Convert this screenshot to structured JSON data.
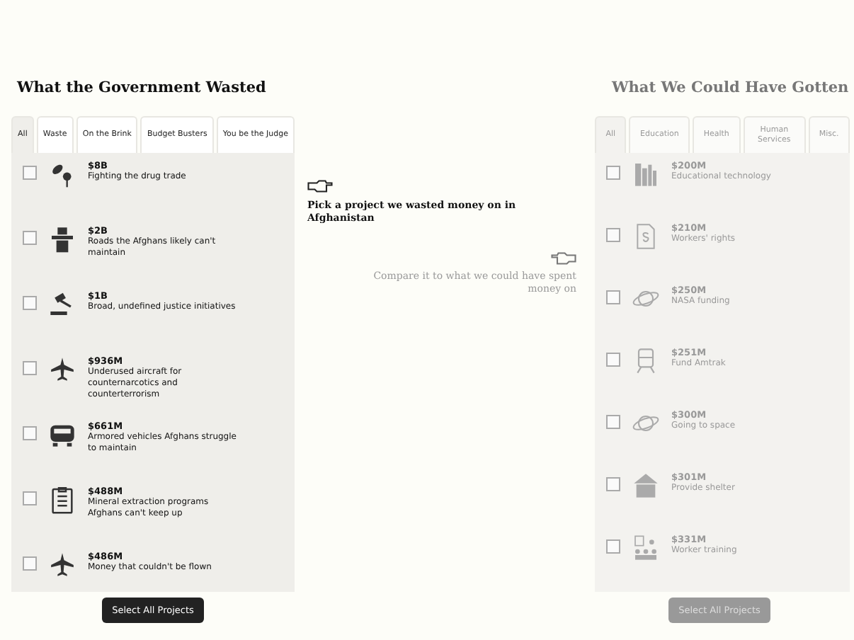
{
  "wasted": {
    "title": "What the Government Wasted",
    "disabled": false,
    "tabs": [
      {
        "label": "All",
        "selected": true
      },
      {
        "label": "Waste",
        "selected": false
      },
      {
        "label": "On the Brink",
        "selected": false
      },
      {
        "label": "Budget Busters",
        "selected": false
      },
      {
        "label": "You be the Judge",
        "selected": false
      }
    ],
    "items": [
      {
        "amount": "$8B",
        "text": "Fighting the drug trade",
        "kind": "plant",
        "checked": false
      },
      {
        "amount": "$2B",
        "text": "Roads the Afghans likely can't maintain",
        "kind": "road",
        "checked": false
      },
      {
        "amount": "$1B",
        "text": "Broad, undefined justice initiatives",
        "kind": "gavel",
        "checked": false
      },
      {
        "amount": "$936M",
        "text": "Underused aircraft for counternarcotics and counterterrorism",
        "kind": "plane",
        "checked": false
      },
      {
        "amount": "$661M",
        "text": "Armored vehicles Afghans struggle to maintain",
        "kind": "vehicle",
        "checked": false
      },
      {
        "amount": "$488M",
        "text": "Mineral extraction programs Afghans can't keep up",
        "kind": "clipboard",
        "checked": false
      },
      {
        "amount": "$486M",
        "text": "Money that couldn't be flown",
        "kind": "plane",
        "checked": false
      }
    ],
    "button": "Select All Projects"
  },
  "instructions": [
    {
      "text": "Pick a project we wasted money on in Afghanistan",
      "kind": "pick"
    },
    {
      "text": "Compare it to what we could have spent money on",
      "kind": "compare"
    }
  ],
  "gotten": {
    "title": "What We Could Have Gotten",
    "disabled": true,
    "tabs": [
      {
        "label": "All",
        "selected": true
      },
      {
        "label": "Education",
        "selected": false
      },
      {
        "label": "Health",
        "selected": false
      },
      {
        "label": "Human Services",
        "selected": false
      },
      {
        "label": "Misc.",
        "selected": false
      }
    ],
    "items": [
      {
        "amount": "$200M",
        "text": "Educational technology",
        "kind": "books",
        "checked": false
      },
      {
        "amount": "$210M",
        "text": "Workers' rights",
        "kind": "document",
        "checked": false
      },
      {
        "amount": "$250M",
        "text": "NASA funding",
        "kind": "planet",
        "checked": false
      },
      {
        "amount": "$251M",
        "text": "Fund Amtrak",
        "kind": "train",
        "checked": false
      },
      {
        "amount": "$300M",
        "text": "Going to space",
        "kind": "planet",
        "checked": false
      },
      {
        "amount": "$301M",
        "text": "Provide shelter",
        "kind": "house",
        "checked": false
      },
      {
        "amount": "$331M",
        "text": "Worker training",
        "kind": "people",
        "checked": false
      }
    ],
    "button": "Select All Projects"
  }
}
